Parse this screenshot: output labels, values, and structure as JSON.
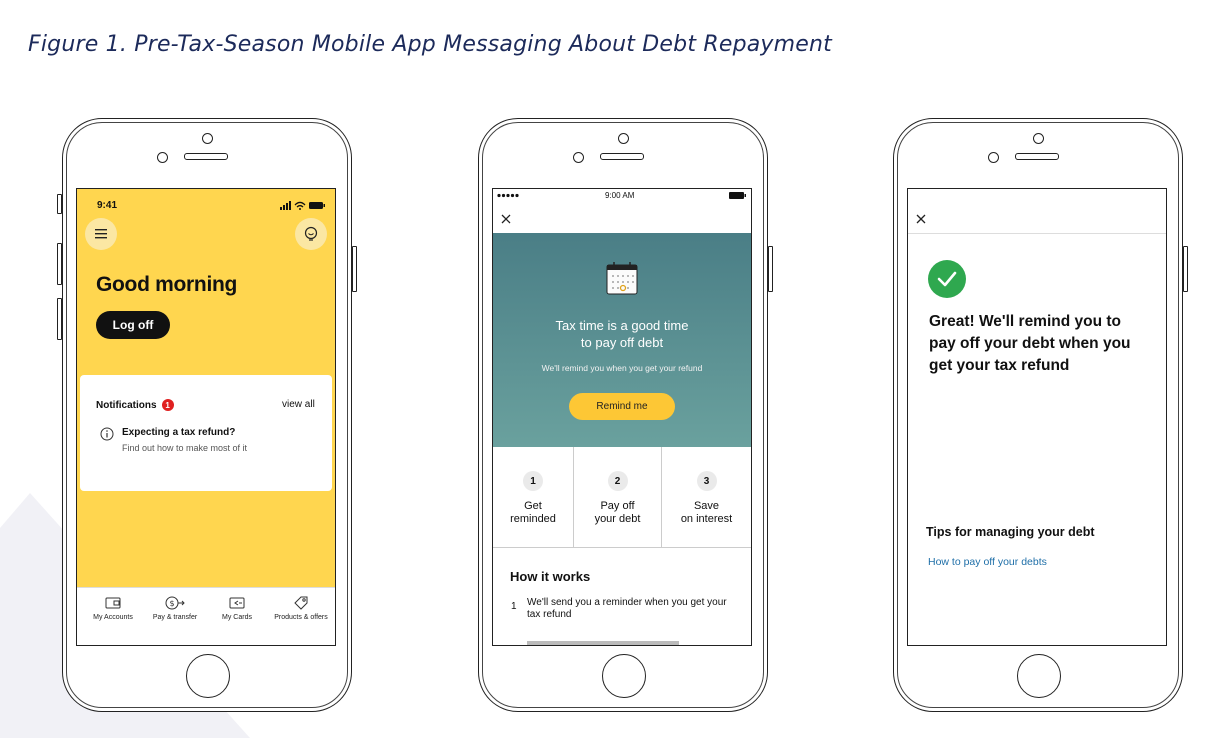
{
  "figure": {
    "title": "Figure 1. Pre-Tax-Season Mobile App Messaging About Debt Repayment"
  },
  "phone1": {
    "status_time": "9:41",
    "greeting": "Good morning",
    "logoff_label": "Log off",
    "notifications_label": "Notifications",
    "notifications_count": "1",
    "view_all_label": "view all",
    "notice_title": "Expecting a tax refund?",
    "notice_subtitle": "Find out how to make most of it",
    "nav": [
      {
        "label": "My Accounts",
        "icon": "wallet-icon"
      },
      {
        "label": "Pay & transfer",
        "icon": "pay-transfer-icon"
      },
      {
        "label": "My Cards",
        "icon": "cards-icon"
      },
      {
        "label": "Products & offers",
        "icon": "tag-icon"
      }
    ],
    "accent_color": "#ffd64f"
  },
  "phone2": {
    "status_time": "9:00 AM",
    "hero_title_line1": "Tax time is a good time",
    "hero_title_line2": "to pay off debt",
    "hero_subtitle": "We'll remind you when you get your refund",
    "remind_label": "Remind me",
    "steps": [
      {
        "num": "1",
        "text": "Get\nreminded"
      },
      {
        "num": "2",
        "text": "Pay off\nyour debt"
      },
      {
        "num": "3",
        "text": "Save\non interest"
      }
    ],
    "how_title": "How it works",
    "how_item_num": "1",
    "how_item_text": "We'll send you a reminder when you get your tax refund",
    "accent_color": "#4a7e86",
    "button_color": "#fdc735"
  },
  "phone3": {
    "confirm_text": "Great! We'll remind you to pay off your debt when you get your tax refund",
    "tips_title": "Tips for managing your debt",
    "tips_link": "How to pay off your debts",
    "check_color": "#2fa84f",
    "link_color": "#1f6fa8"
  }
}
